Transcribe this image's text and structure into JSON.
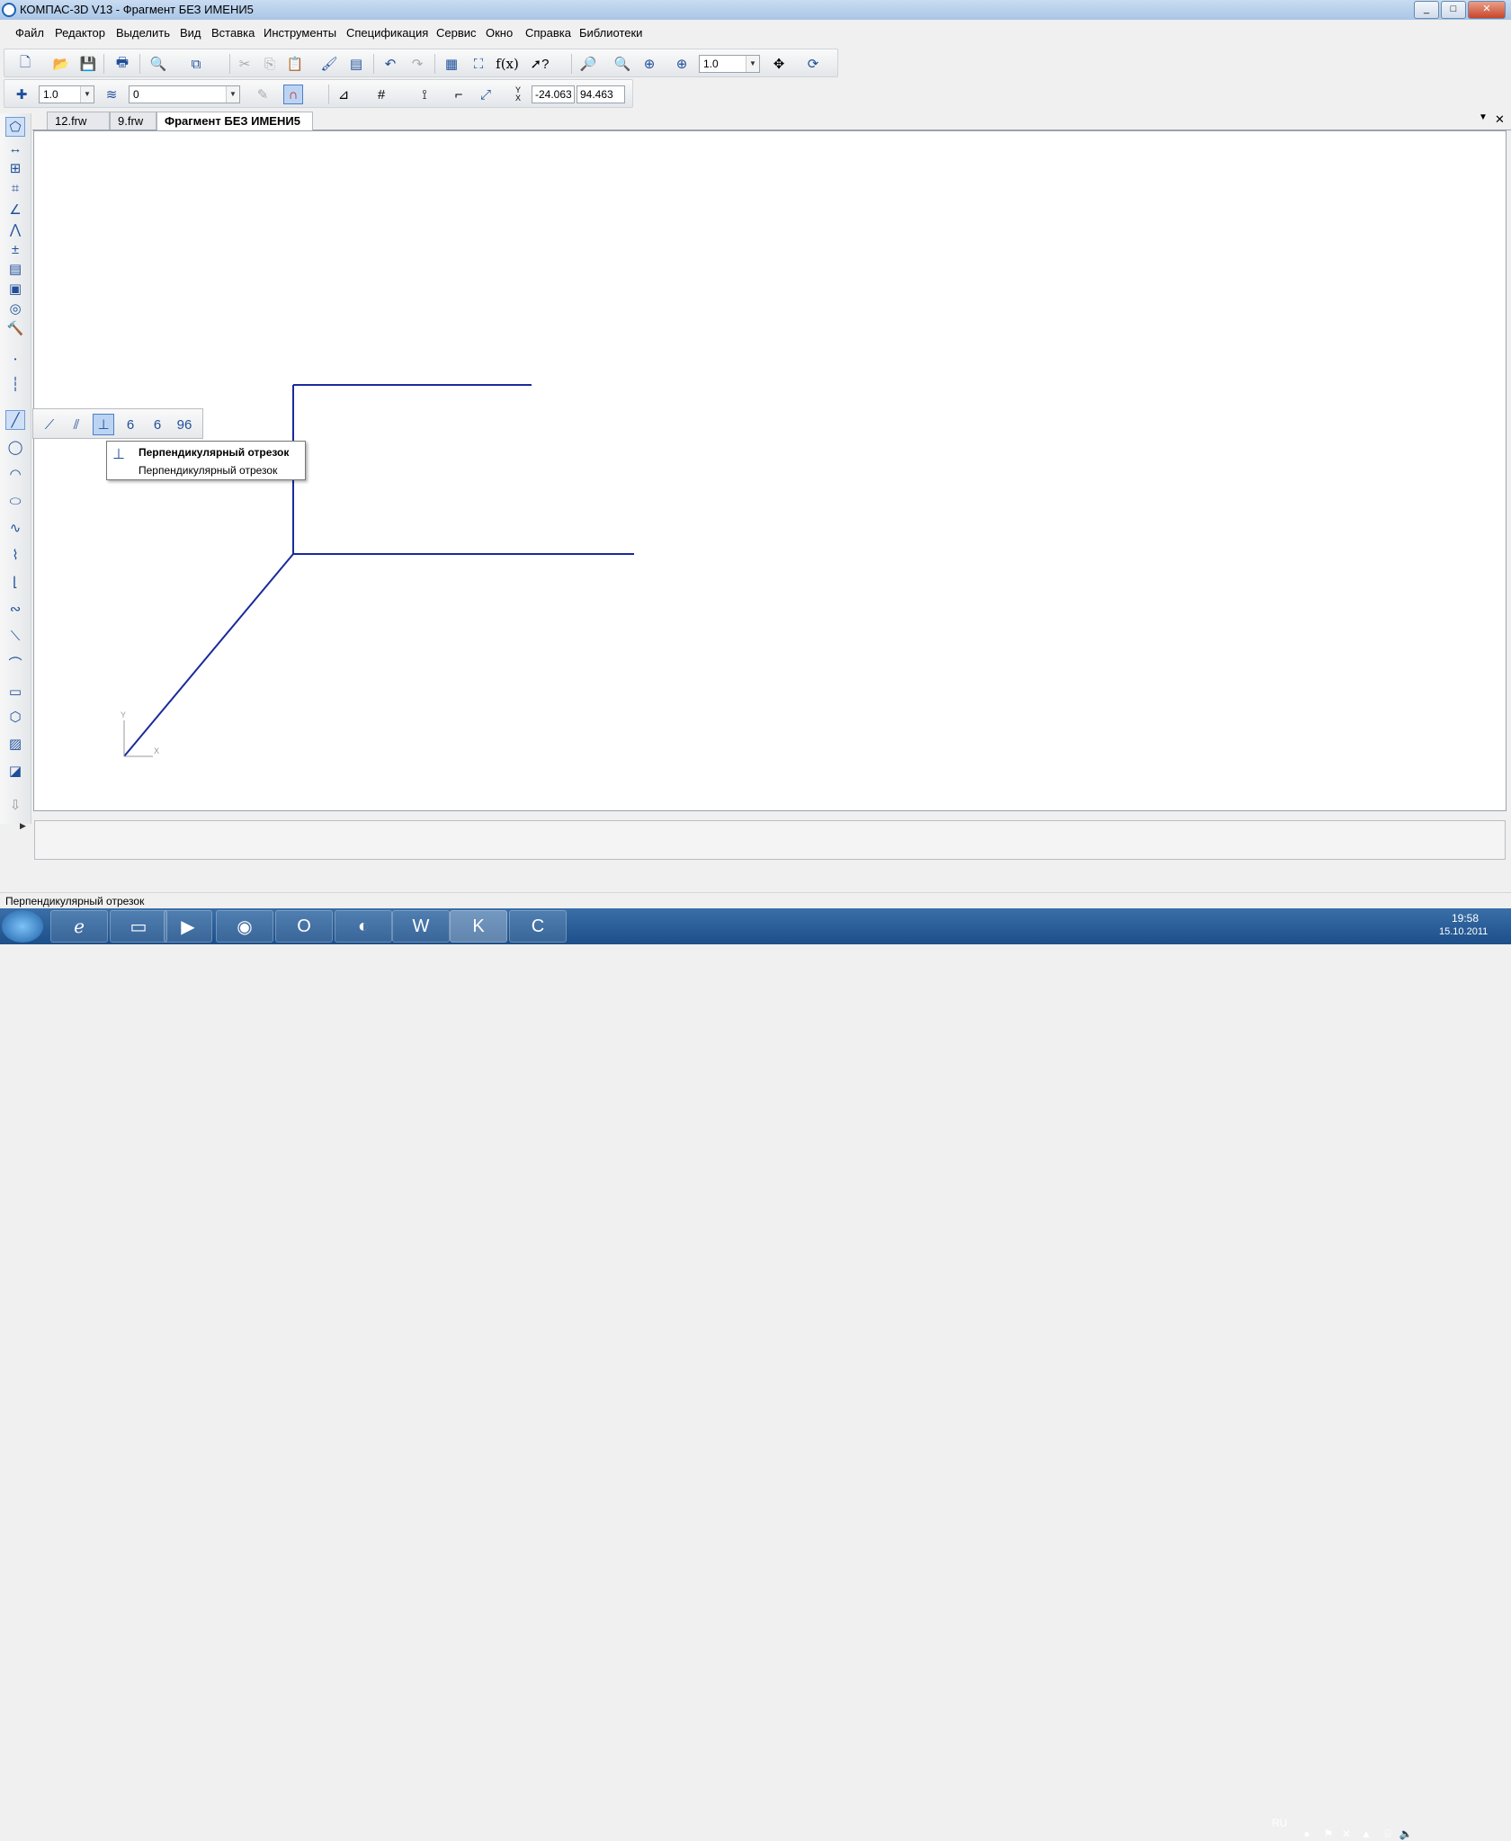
{
  "window": {
    "title": "КОМПАС-3D V13 - Фрагмент БЕЗ ИМЕНИ5",
    "min": "_",
    "max": "□",
    "close": "✕"
  },
  "menu": [
    "Файл",
    "Редактор",
    "Выделить",
    "Вид",
    "Вставка",
    "Инструменты",
    "Спецификация",
    "Сервис",
    "Окно",
    "Справка",
    "Библиотеки"
  ],
  "toolbar1": {
    "zoom_value": "1.0"
  },
  "toolbar2": {
    "step_value": "1.0",
    "layer_value": "0",
    "coord_y_label": "Y",
    "coord_x_label": "X",
    "coord_x_value": "-24.063",
    "coord_y_value": "94.463"
  },
  "tabs": {
    "items": [
      "12.frw",
      "9.frw",
      "Фрагмент БЕЗ ИМЕНИ5"
    ],
    "active_index": 2,
    "menu_arrow": "▼",
    "close": "✕"
  },
  "canvas": {
    "line_color": "#1a2a9c",
    "axis_y_label": "Y",
    "axis_x_label": "X"
  },
  "tooltip": {
    "title": "Перпендикулярный отрезок",
    "description": "Перпендикулярный отрезок"
  },
  "status": {
    "text": "Перпендикулярный отрезок"
  },
  "taskbar": {
    "language": "RU",
    "time": "19:58",
    "date": "15.10.2011"
  },
  "colors": {
    "accent": "#1f4f9a",
    "drawing": "#1a2a9c"
  }
}
